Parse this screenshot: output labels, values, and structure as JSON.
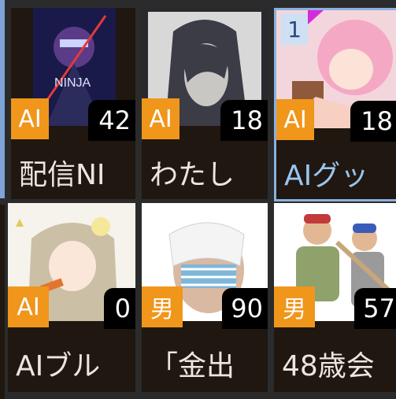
{
  "tiles": [
    {
      "badge": "AI",
      "count": "42",
      "title": "配信NI"
    },
    {
      "badge": "AI",
      "count": "18",
      "title": "わたし"
    },
    {
      "badge": "AI",
      "count": "18",
      "title": "AIグッ",
      "rank": "1"
    },
    {
      "badge": "AI",
      "count": "0",
      "title": "AIブル"
    },
    {
      "badge": "男",
      "count": "90",
      "title": "「金出"
    },
    {
      "badge": "男",
      "count": "57",
      "title": "48歳会"
    }
  ],
  "colors": {
    "badge": "#f0961b",
    "tile_bg": "#1f1710",
    "selected_border": "#8ab0e0",
    "page_bg": "#2b2b2b"
  }
}
